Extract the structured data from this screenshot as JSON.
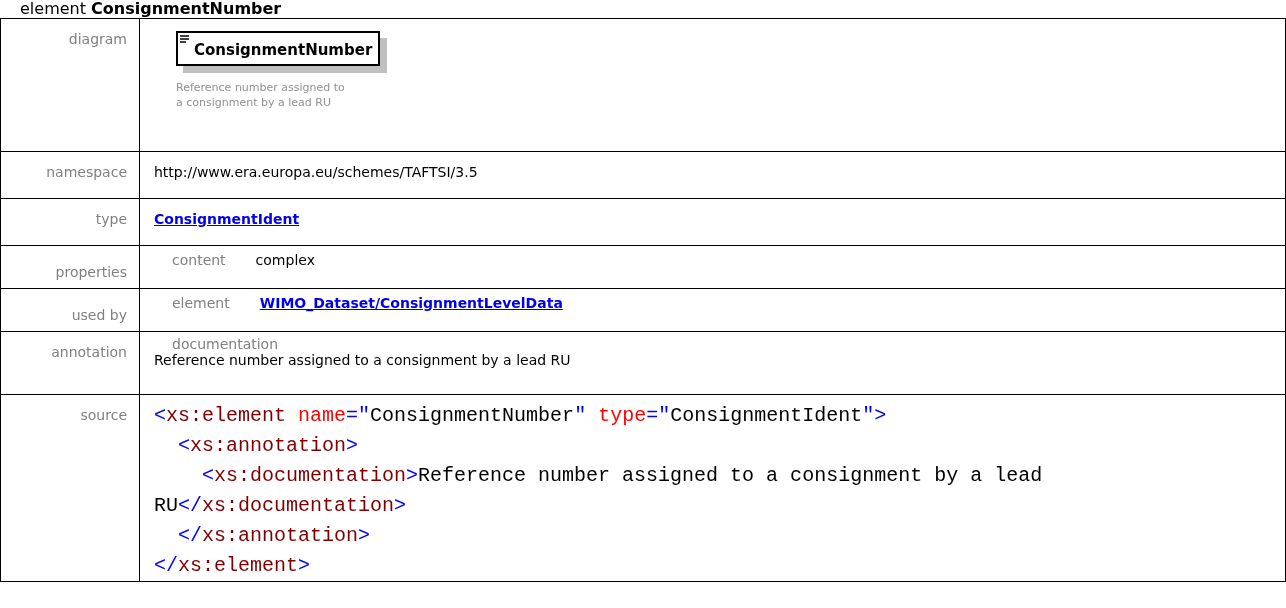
{
  "heading": {
    "kind_label": "element",
    "name": "ConsignmentNumber"
  },
  "diagram": {
    "label": "diagram",
    "element_name": "ConsignmentNumber",
    "description_lines": [
      "Reference number assigned to",
      "a consignment by a lead RU"
    ]
  },
  "namespace": {
    "label": "namespace",
    "value": "http://www.era.europa.eu/schemes/TAFTSI/3.5"
  },
  "type": {
    "label": "type",
    "link": "ConsignmentIdent"
  },
  "properties": {
    "label": "properties",
    "key": "content",
    "value": "complex"
  },
  "used_by": {
    "label": "used by",
    "key": "element",
    "link": "WIMO_Dataset/ConsignmentLevelData"
  },
  "annotation": {
    "label": "annotation",
    "key": "documentation",
    "text": "Reference number assigned to a consignment by a lead RU"
  },
  "source": {
    "label": "source",
    "lines": [
      {
        "kind": "top",
        "tokens": [
          {
            "kind": "bracket",
            "text": "<"
          },
          {
            "kind": "tag",
            "text": "xs:element"
          },
          {
            "kind": "attr",
            "text": " name"
          },
          {
            "kind": "bracket",
            "text": "=\""
          },
          {
            "kind": "text",
            "text": "ConsignmentNumber"
          },
          {
            "kind": "bracket",
            "text": "\""
          },
          {
            "kind": "attr",
            "text": " type"
          },
          {
            "kind": "bracket",
            "text": "=\""
          },
          {
            "kind": "text",
            "text": "ConsignmentIdent"
          },
          {
            "kind": "bracket",
            "text": "\">"
          }
        ]
      },
      {
        "kind": "nested",
        "tokens": [
          {
            "kind": "bracket",
            "text": "<"
          },
          {
            "kind": "tag",
            "text": "xs:annotation"
          },
          {
            "kind": "bracket",
            "text": ">"
          }
        ]
      },
      {
        "kind": "nested2",
        "tokens": [
          {
            "kind": "bracket",
            "text": "<"
          },
          {
            "kind": "tag",
            "text": "xs:documentation"
          },
          {
            "kind": "bracket",
            "text": ">"
          },
          {
            "kind": "text",
            "text": "Reference number assigned to a consignment by a lead"
          }
        ]
      },
      {
        "kind": "top",
        "tokens": [
          {
            "kind": "text",
            "text": "RU"
          },
          {
            "kind": "bracket",
            "text": "</"
          },
          {
            "kind": "tag",
            "text": "xs:documentation"
          },
          {
            "kind": "bracket",
            "text": ">"
          }
        ]
      },
      {
        "kind": "nested",
        "tokens": [
          {
            "kind": "bracket",
            "text": "</"
          },
          {
            "kind": "tag",
            "text": "xs:annotation"
          },
          {
            "kind": "bracket",
            "text": ">"
          }
        ]
      },
      {
        "kind": "top",
        "tokens": [
          {
            "kind": "bracket",
            "text": "</"
          },
          {
            "kind": "tag",
            "text": "xs:element"
          },
          {
            "kind": "bracket",
            "text": ">"
          }
        ]
      }
    ]
  }
}
